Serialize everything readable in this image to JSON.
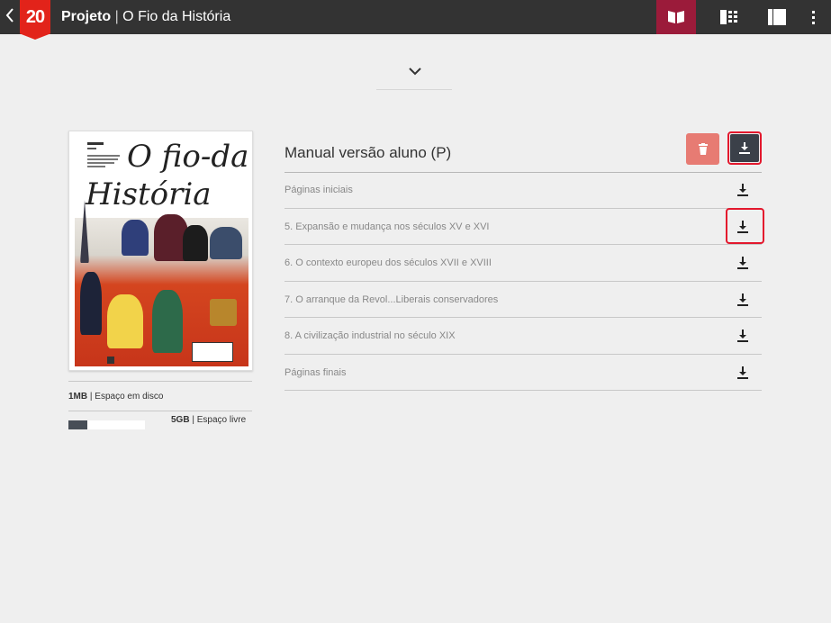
{
  "topbar": {
    "back_icon": "chevron-left-icon",
    "logo_text": "20",
    "title_bold": "Projeto",
    "title_sep": " | ",
    "title_rest": "O Fio da História",
    "buttons": [
      {
        "icon": "book-open-icon",
        "active": true
      },
      {
        "icon": "grid-sidebar-icon",
        "active": false
      },
      {
        "icon": "sidebar-icon",
        "active": false
      },
      {
        "icon": "more-vertical-icon",
        "active": false
      }
    ],
    "active_color": "#9b1b3a"
  },
  "cover": {
    "title_line1": "O fio-da",
    "title_line2": "História"
  },
  "storage": {
    "disk_size": "1MB",
    "disk_label": " | Espaço em disco",
    "free_size": "5GB",
    "free_label": " | Espaço livre",
    "used_fraction": 0.25
  },
  "manual": {
    "title": "Manual versão aluno (P)",
    "delete_icon": "trash-icon",
    "download_icon": "download-icon",
    "highlight_color": "#e3182d",
    "chapters": [
      {
        "label": "Páginas iniciais"
      },
      {
        "label": "5. Expansão e mudança nos séculos XV e XVI"
      },
      {
        "label": "6. O contexto europeu dos séculos XVII e XVIII"
      },
      {
        "label": "7. O arranque da Revol...Liberais conservadores"
      },
      {
        "label": "8. A civilização industrial no século XIX"
      },
      {
        "label": "Páginas finais"
      }
    ]
  }
}
